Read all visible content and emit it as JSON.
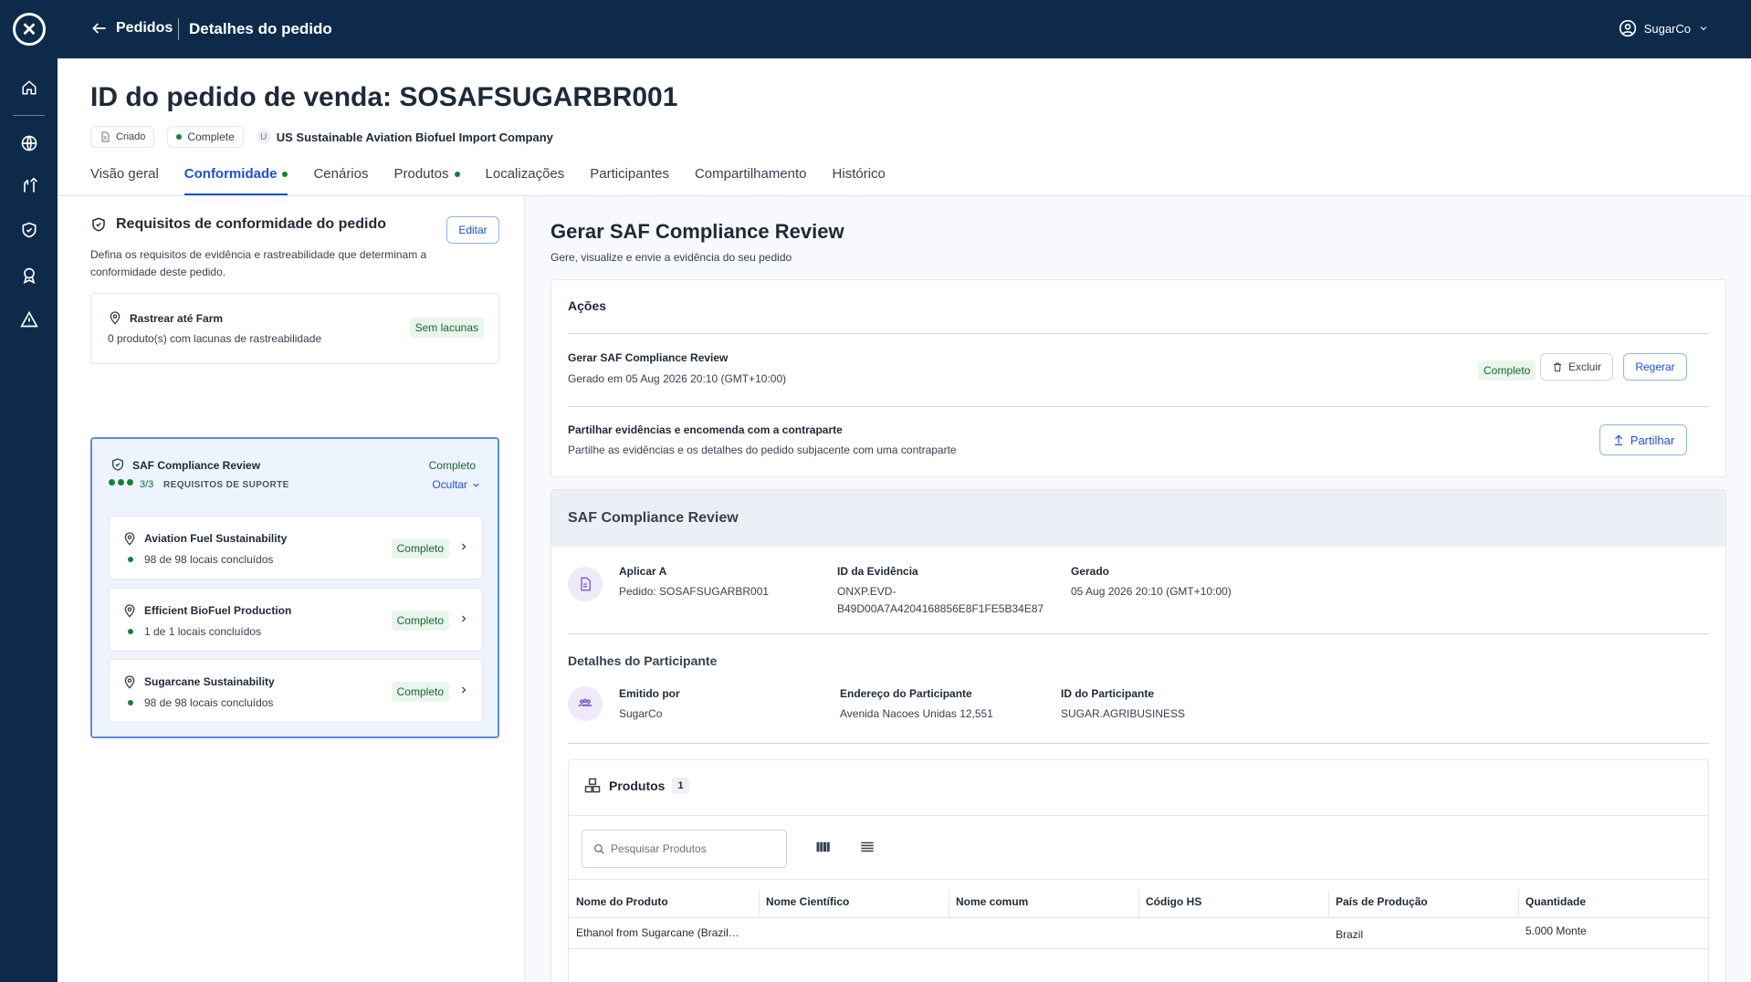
{
  "nav": {
    "back_label": "Pedidos",
    "page_title": "Detalhes do pedido",
    "user_name": "SugarCo"
  },
  "order": {
    "title": "ID do pedido de venda: SOSAFSUGARBR001",
    "created_label": "Criado",
    "status_label": "Complete",
    "company_initial": "U",
    "company": "US Sustainable Aviation Biofuel Import Company"
  },
  "tabs": [
    {
      "label": "Visão geral"
    },
    {
      "label": "Conformidade"
    },
    {
      "label": "Cenários"
    },
    {
      "label": "Produtos"
    },
    {
      "label": "Localizações"
    },
    {
      "label": "Participantes"
    },
    {
      "label": "Compartilhamento"
    },
    {
      "label": "Histórico"
    }
  ],
  "requirements": {
    "title": "Requisitos de conformidade do pedido",
    "edit_label": "Editar",
    "description": "Defina os requisitos de evidência e rastreabilidade que determinam a conformidade deste pedido.",
    "trace": {
      "title": "Rastrear até Farm",
      "subtitle": "0 produto(s) com lacunas de rastreabilidade",
      "badge": "Sem lacunas"
    },
    "saf": {
      "title": "SAF Compliance Review",
      "status": "Completo",
      "fraction": "3/3",
      "support_label": "REQUISITOS DE SUPORTE",
      "hide_label": "Ocultar",
      "items": [
        {
          "name": "Aviation Fuel Sustainability",
          "sub": "98 de 98 locais concluídos",
          "badge": "Completo"
        },
        {
          "name": "Efficient BioFuel Production",
          "sub": "1 de 1 locais concluídos",
          "badge": "Completo"
        },
        {
          "name": "Sugarcane Sustainability",
          "sub": "98 de 98 locais concluídos",
          "badge": "Completo"
        }
      ]
    }
  },
  "generate": {
    "title": "Gerar SAF Compliance Review",
    "subtitle": "Gere, visualize e envie a evidência do seu pedido",
    "actions_heading": "Ações",
    "action1": {
      "title": "Gerar SAF Compliance Review",
      "subtitle": "Gerado em 05 Aug 2026 20:10 (GMT+10:00)",
      "badge": "Completo",
      "delete_label": "Excluir",
      "regen_label": "Regerar"
    },
    "action2": {
      "title": "Partilhar evidências e encomenda com a contraparte",
      "subtitle": "Partilhe as evidências e os detalhes do pedido subjacente com uma contraparte",
      "share_label": "Partilhar"
    }
  },
  "review": {
    "heading": "SAF Compliance Review",
    "apply_label": "Aplicar A",
    "apply_value": "Pedido: SOSAFSUGARBR001",
    "evidence_label": "ID da Evidência",
    "evidence_value_1": "ONXP.EVD-",
    "evidence_value_2": "B49D00A7A4204168856E8F1FE5B34E87",
    "generated_label": "Gerado",
    "generated_value": "05 Aug 2026 20:10 (GMT+10:00)",
    "participant_heading": "Detalhes do Participante",
    "issued_label": "Emitido por",
    "issued_value": "SugarCo",
    "address_label": "Endereço do Participante",
    "address_value": "Avenida Nacoes Unidas 12,551",
    "pid_label": "ID do Participante",
    "pid_value": "SUGAR.AGRIBUSINESS"
  },
  "products": {
    "heading": "Produtos",
    "count": "1",
    "search_placeholder": "Pesquisar Produtos",
    "columns": [
      "Nome do Produto",
      "Nome Científico",
      "Nome comum",
      "Código HS",
      "País de Produção",
      "Quantidade"
    ],
    "rows": [
      [
        "Ethanol from Sugarcane (Brazil…",
        "",
        "",
        "",
        "Brazil",
        "5.000 Monte"
      ]
    ]
  }
}
